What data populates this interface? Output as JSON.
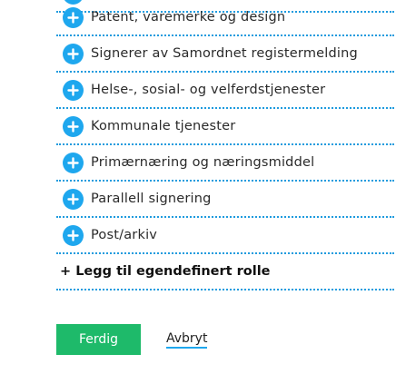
{
  "roles": [
    {
      "label": "Patent, varemerke og design",
      "icon": "plus-icon"
    },
    {
      "label": "Signerer av Samordnet registermelding",
      "icon": "plus-icon"
    },
    {
      "label": "Helse-, sosial- og velferdstjenester",
      "icon": "plus-icon"
    },
    {
      "label": "Kommunale tjenester",
      "icon": "plus-icon"
    },
    {
      "label": "Primærnæring og næringsmiddel",
      "icon": "plus-icon"
    },
    {
      "label": "Parallell signering",
      "icon": "plus-icon"
    },
    {
      "label": "Post/arkiv",
      "icon": "plus-icon"
    }
  ],
  "add_custom_role": "+ Legg til egendefinert rolle",
  "actions": {
    "done_label": "Ferdig",
    "cancel_label": "Avbryt"
  },
  "colors": {
    "accent_blue": "#1ea7ee",
    "done_green": "#1eba6a",
    "divider": "#1f9bde"
  }
}
